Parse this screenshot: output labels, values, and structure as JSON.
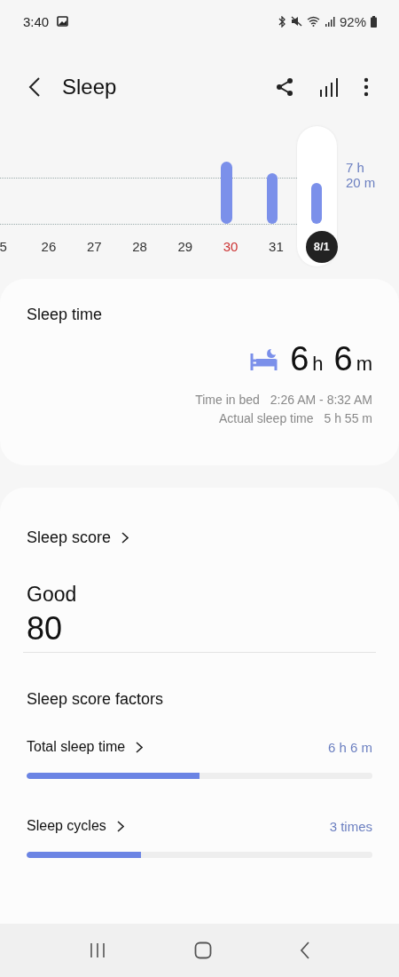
{
  "status_bar": {
    "time": "3:40",
    "battery": "92%"
  },
  "header": {
    "title": "Sleep"
  },
  "chart": {
    "goal_label": "7 h\n20 m",
    "days": [
      {
        "label": "5",
        "kind": "day",
        "selected": false
      },
      {
        "label": "26",
        "kind": "day",
        "selected": false
      },
      {
        "label": "27",
        "kind": "day",
        "selected": false
      },
      {
        "label": "28",
        "kind": "day",
        "selected": false
      },
      {
        "label": "29",
        "kind": "day",
        "selected": false
      },
      {
        "label": "30",
        "kind": "sunday",
        "selected": false
      },
      {
        "label": "31",
        "kind": "day",
        "selected": false
      },
      {
        "label": "8/1",
        "kind": "day",
        "selected": true
      }
    ]
  },
  "sleep_time": {
    "title": "Sleep time",
    "hours": "6",
    "hours_unit": "h",
    "minutes": "6",
    "minutes_unit": "m",
    "details": [
      {
        "label": "Time in bed",
        "value": "2:26 AM - 8:32 AM"
      },
      {
        "label": "Actual sleep time",
        "value": "5 h 55 m"
      }
    ]
  },
  "sleep_score": {
    "title": "Sleep score",
    "rating": "Good",
    "score": "80",
    "factors_title": "Sleep score factors",
    "factors": [
      {
        "name": "Total sleep time",
        "value": "6 h 6 m",
        "level": 0.5
      },
      {
        "name": "Sleep cycles",
        "value": "3 times",
        "level": 0.33
      }
    ]
  }
}
